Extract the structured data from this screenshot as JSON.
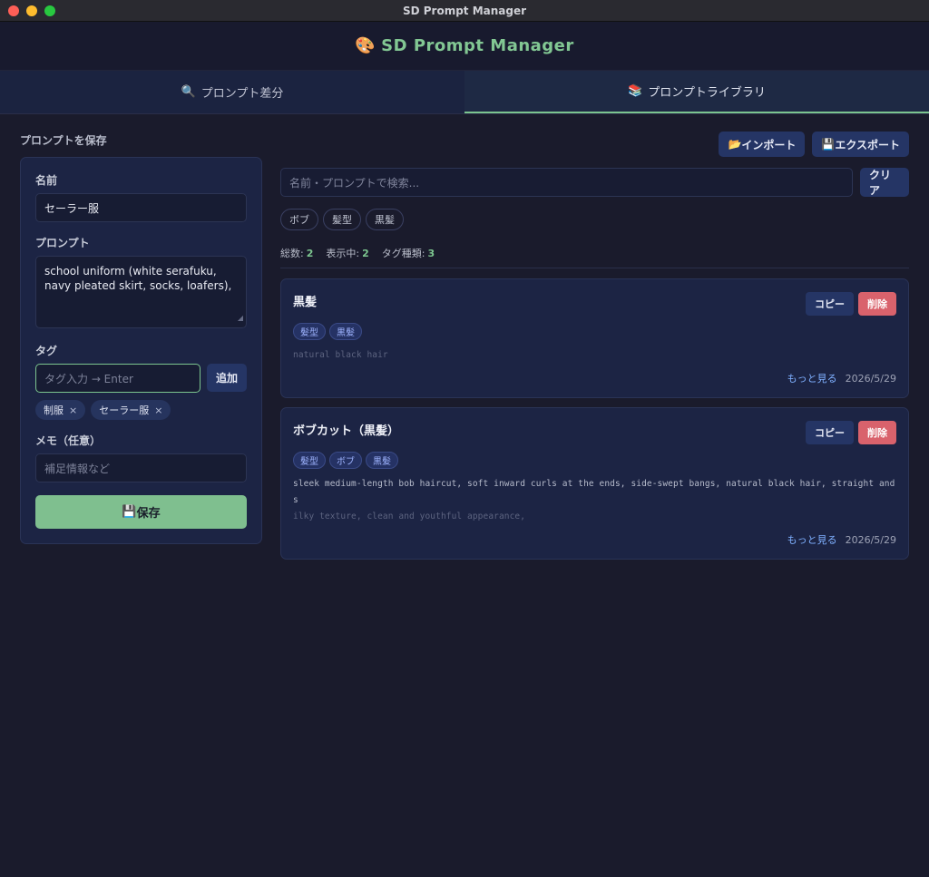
{
  "window": {
    "title": "SD Prompt Manager"
  },
  "app": {
    "emoji": "🎨",
    "title": "SD Prompt Manager"
  },
  "tabs": [
    {
      "icon": "🔍",
      "label": "プロンプト差分"
    },
    {
      "icon": "📚",
      "label": "プロンプトライブラリ"
    }
  ],
  "left": {
    "section_title": "プロンプトを保存",
    "name_label": "名前",
    "name_value": "セーラー服",
    "prompt_label": "プロンプト",
    "prompt_value": "school uniform (white serafuku, navy pleated skirt, socks, loafers),",
    "tag_label": "タグ",
    "tag_placeholder": "タグ入力 → Enter",
    "add_button": "追加",
    "chips": [
      "制服",
      "セーラー服"
    ],
    "chip_remove": "×",
    "memo_label": "メモ（任意）",
    "memo_placeholder": "補足情報など",
    "save_icon": "💾",
    "save_button": "保存"
  },
  "right": {
    "import": {
      "icon": "📂",
      "label": "インポート"
    },
    "export": {
      "icon": "💾",
      "label": "エクスポート"
    },
    "search_placeholder": "名前・プロンプトで検索...",
    "clear_button": "クリア",
    "filter_tags": [
      "ボブ",
      "髪型",
      "黒髪"
    ],
    "stats": {
      "total_label": "総数:",
      "total": "2",
      "shown_label": "表示中:",
      "shown": "2",
      "tagtypes_label": "タグ種類:",
      "tagtypes": "3"
    },
    "cards": [
      {
        "title": "黒髪",
        "tags": [
          "髪型",
          "黒髪"
        ],
        "prompt_line1": "natural black hair",
        "prompt_line2": "",
        "more": "もっと見る",
        "date": "2026/5/29",
        "copy": "コピー",
        "delete": "削除"
      },
      {
        "title": "ボブカット（黒髪）",
        "tags": [
          "髪型",
          "ボブ",
          "黒髪"
        ],
        "prompt_line1": "sleek medium-length bob haircut, soft inward curls at the ends, side-swept bangs, natural black hair, straight and s",
        "prompt_line2": "ilky texture, clean and youthful appearance,",
        "more": "もっと見る",
        "date": "2026/5/29",
        "copy": "コピー",
        "delete": "削除"
      }
    ]
  },
  "colors": {
    "accent": "#7cc58f",
    "danger": "#d9626c",
    "link": "#7fb0ff",
    "background": "#1a1b2c"
  }
}
